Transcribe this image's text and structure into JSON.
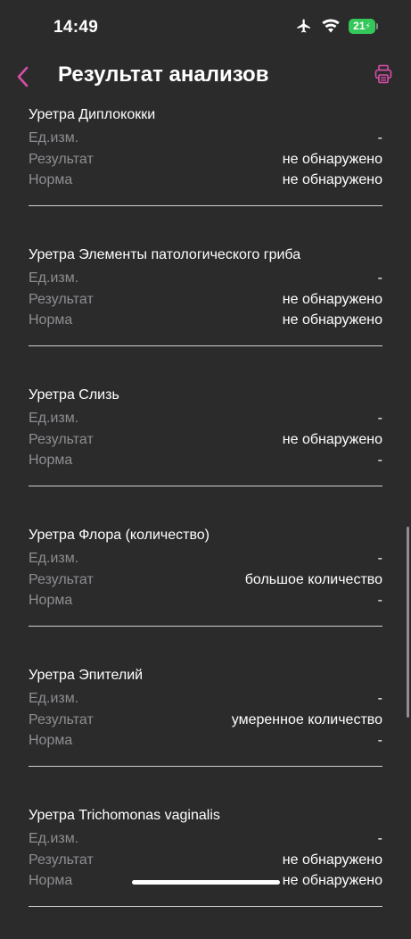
{
  "status": {
    "time": "14:49",
    "battery": "21",
    "icons": [
      "airplane-icon",
      "wifi-icon",
      "battery-charging-icon"
    ]
  },
  "nav": {
    "title": "Результат анализов",
    "back_icon": "chevron-left-icon",
    "print_icon": "printer-icon",
    "accent_color": "#d64fa8"
  },
  "items": [
    {
      "title": "Уретра Диплококки",
      "unit_label": "Ед.изм.",
      "unit": "-",
      "result_label": "Результат",
      "result": "не обнаружено",
      "norm_label": "Норма",
      "norm": "не обнаружено"
    },
    {
      "title": "Уретра Элементы патологического гриба",
      "unit_label": "Ед.изм.",
      "unit": "-",
      "result_label": "Результат",
      "result": "не обнаружено",
      "norm_label": "Норма",
      "norm": "не обнаружено"
    },
    {
      "title": "Уретра Слизь",
      "unit_label": "Ед.изм.",
      "unit": "-",
      "result_label": "Результат",
      "result": "не обнаружено",
      "norm_label": "Норма",
      "norm": "-"
    },
    {
      "title": "Уретра Флора (количество)",
      "unit_label": "Ед.изм.",
      "unit": "-",
      "result_label": "Результат",
      "result": "большое количество",
      "norm_label": "Норма",
      "norm": "-"
    },
    {
      "title": "Уретра Эпителий",
      "unit_label": "Ед.изм.",
      "unit": "-",
      "result_label": "Результат",
      "result": "умеренное количество",
      "norm_label": "Норма",
      "norm": "-"
    },
    {
      "title": "Уретра Trichomonas vaginalis",
      "unit_label": "Ед.изм.",
      "unit": "-",
      "result_label": "Результат",
      "result": "не обнаружено",
      "norm_label": "Норма",
      "norm": "не обнаружено"
    }
  ]
}
